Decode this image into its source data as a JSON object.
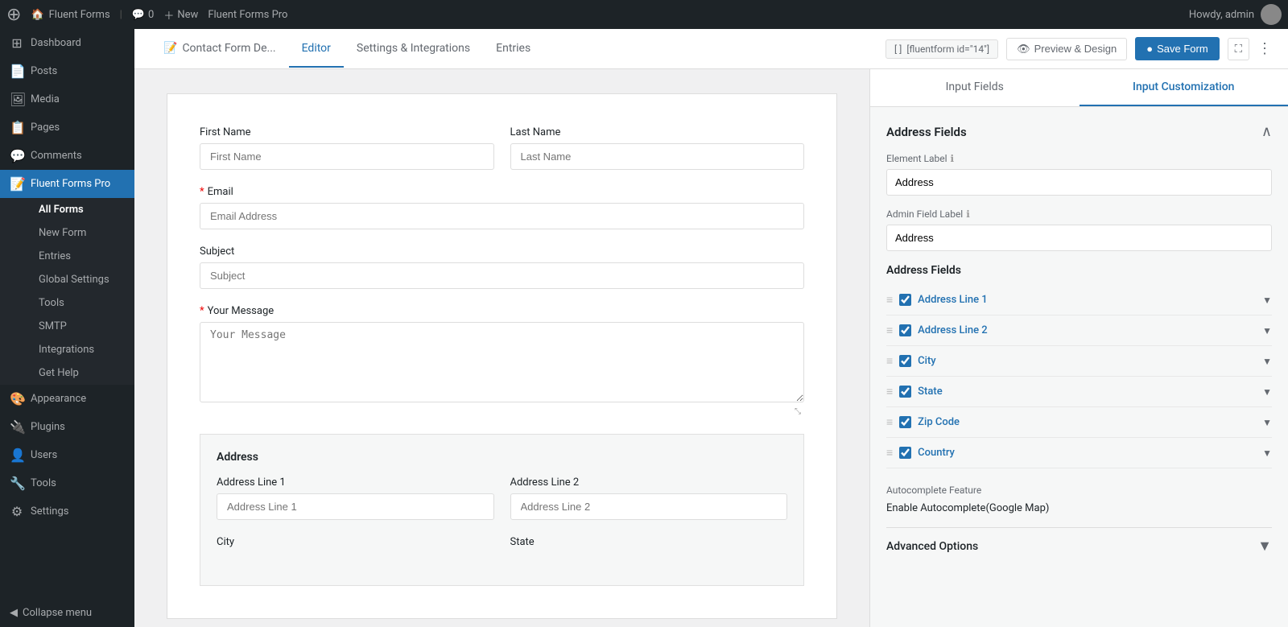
{
  "topbar": {
    "logo": "⊕",
    "site_label": "Fluent Forms",
    "comments_label": "0",
    "new_label": "New",
    "plugin_label": "Fluent Forms Pro",
    "user_label": "Howdy, admin"
  },
  "sidebar": {
    "items": [
      {
        "id": "dashboard",
        "label": "Dashboard",
        "icon": "⊞"
      },
      {
        "id": "posts",
        "label": "Posts",
        "icon": "📄"
      },
      {
        "id": "media",
        "label": "Media",
        "icon": "🖼"
      },
      {
        "id": "pages",
        "label": "Pages",
        "icon": "📋"
      },
      {
        "id": "comments",
        "label": "Comments",
        "icon": "💬"
      },
      {
        "id": "fluent-forms",
        "label": "Fluent Forms Pro",
        "icon": "📝",
        "active": true
      }
    ],
    "sub_items": [
      {
        "id": "all-forms",
        "label": "All Forms",
        "active_parent": true
      },
      {
        "id": "new-form",
        "label": "New Form"
      },
      {
        "id": "entries",
        "label": "Entries"
      },
      {
        "id": "global-settings",
        "label": "Global Settings"
      },
      {
        "id": "tools",
        "label": "Tools"
      },
      {
        "id": "smtp",
        "label": "SMTP"
      },
      {
        "id": "integrations",
        "label": "Integrations"
      },
      {
        "id": "get-help",
        "label": "Get Help"
      }
    ],
    "bottom_items": [
      {
        "id": "appearance",
        "label": "Appearance",
        "icon": "🎨"
      },
      {
        "id": "plugins",
        "label": "Plugins",
        "icon": "🔌"
      },
      {
        "id": "users",
        "label": "Users",
        "icon": "👤"
      },
      {
        "id": "tools",
        "label": "Tools",
        "icon": "🔧"
      },
      {
        "id": "settings",
        "label": "Settings",
        "icon": "⚙"
      }
    ],
    "collapse_label": "Collapse menu"
  },
  "tabs": {
    "items": [
      {
        "id": "contact-form-de",
        "label": "Contact Form De...",
        "icon": "📝"
      },
      {
        "id": "editor",
        "label": "Editor",
        "active": true
      },
      {
        "id": "settings",
        "label": "Settings & Integrations"
      },
      {
        "id": "entries",
        "label": "Entries"
      }
    ],
    "shortcode": "[fluentform id=\"14\"]",
    "preview_label": "Preview & Design",
    "save_label": "Save Form"
  },
  "form": {
    "first_name_label": "First Name",
    "first_name_placeholder": "First Name",
    "last_name_label": "Last Name",
    "last_name_placeholder": "Last Name",
    "email_label": "Email",
    "email_placeholder": "Email Address",
    "subject_label": "Subject",
    "subject_placeholder": "Subject",
    "message_label": "Your Message",
    "message_placeholder": "Your Message",
    "address_title": "Address",
    "address_line1_label": "Address Line 1",
    "address_line1_placeholder": "Address Line 1",
    "address_line2_label": "Address Line 2",
    "address_line2_placeholder": "Address Line 2",
    "city_label": "City",
    "state_label": "State"
  },
  "panel": {
    "tab_input_fields": "Input Fields",
    "tab_input_customization": "Input Customization",
    "section_title": "Address Fields",
    "element_label_title": "Element Label",
    "element_label_value": "Address",
    "admin_field_label_title": "Admin Field Label",
    "admin_field_label_value": "Address",
    "address_fields_title": "Address Fields",
    "address_fields": [
      {
        "id": "line1",
        "label": "Address Line 1",
        "checked": true
      },
      {
        "id": "line2",
        "label": "Address Line 2",
        "checked": true
      },
      {
        "id": "city",
        "label": "City",
        "checked": true
      },
      {
        "id": "state",
        "label": "State",
        "checked": true
      },
      {
        "id": "zip",
        "label": "Zip Code",
        "checked": true
      },
      {
        "id": "country",
        "label": "Country",
        "checked": true
      }
    ],
    "autocomplete_section_label": "Autocomplete Feature",
    "autocomplete_toggle_label": "Enable Autocomplete(Google Map)",
    "advanced_options_label": "Advanced Options"
  }
}
